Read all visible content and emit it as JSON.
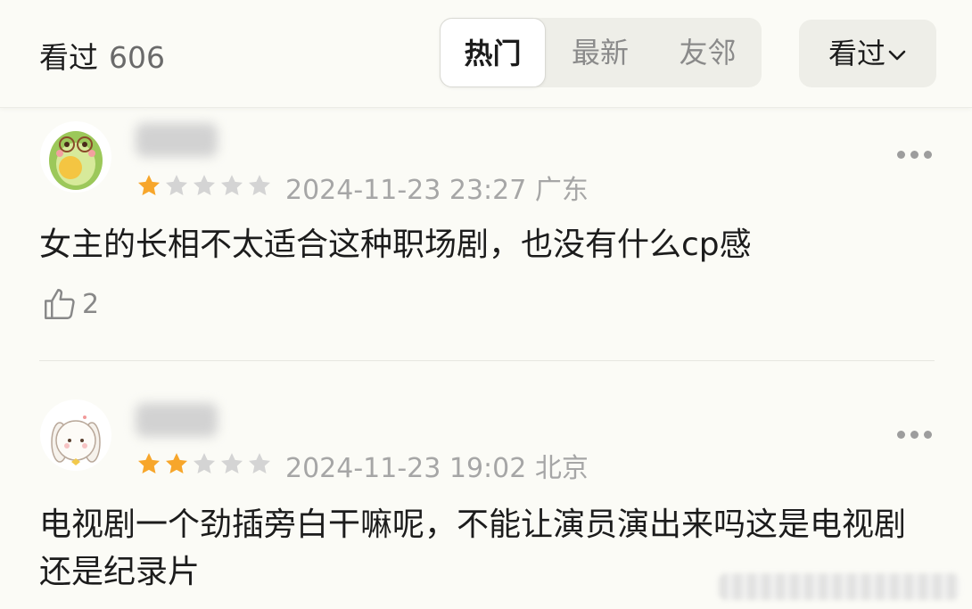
{
  "header": {
    "title": "看过",
    "count": "606",
    "tabs": [
      {
        "label": "热门",
        "active": true
      },
      {
        "label": "最新",
        "active": false
      },
      {
        "label": "友邻",
        "active": false
      }
    ],
    "filter_label": "看过",
    "filter_icon": "chevron-down-icon"
  },
  "colors": {
    "star_filled": "#f7a62b",
    "star_empty": "#d4d4d4",
    "background": "#fbfbf6"
  },
  "comments": [
    {
      "rating": 1,
      "max_rating": 5,
      "date": "2024-11-23 23:27",
      "location": "广东",
      "text": "女主的长相不太适合这种职场剧，也没有什么cp感",
      "likes": "2"
    },
    {
      "rating": 2,
      "max_rating": 5,
      "date": "2024-11-23 19:02",
      "location": "北京",
      "text": "电视剧一个劲插旁白干嘛呢，不能让演员演出来吗这是电视剧还是纪录片"
    }
  ]
}
